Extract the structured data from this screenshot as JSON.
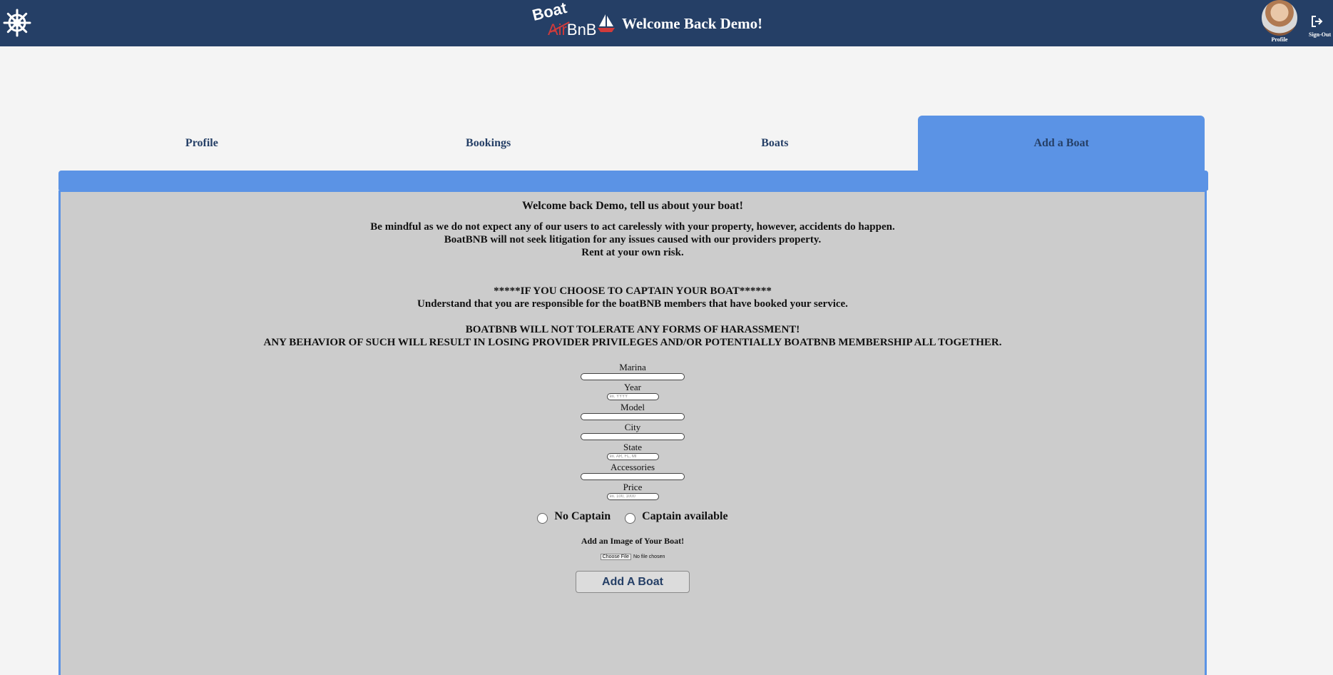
{
  "header": {
    "welcome": "Welcome Back Demo!",
    "logo": {
      "top": "Boat",
      "air": "Air",
      "bnb": "BnB"
    },
    "profile_label": "Profile",
    "signout_label": "Sign-Out",
    "colors": {
      "bar": "#253f66",
      "accent": "#5b93e5",
      "strike": "#d13b3b"
    },
    "icons": [
      "ship-wheel-icon",
      "sailboat-icon",
      "sign-out-icon"
    ]
  },
  "tabs": [
    {
      "label": "Profile",
      "active": false
    },
    {
      "label": "Bookings",
      "active": false
    },
    {
      "label": "Boats",
      "active": false
    },
    {
      "label": "Add a Boat",
      "active": true
    }
  ],
  "panel": {
    "heading": "Welcome back Demo, tell us about your boat!",
    "notice": [
      "Be mindful as we do not expect any of our users to act carelessly with your property, however, accidents do happen.",
      "BoatBNB will not seek litigation for any issues caused with our providers property.",
      "Rent at your own risk."
    ],
    "captain_notice": [
      "*****IF YOU CHOOSE TO CAPTAIN YOUR BOAT******",
      "Understand that you are responsible for the boatBNB members that have booked your service."
    ],
    "harassment": [
      "BOATBNB WILL NOT TOLERATE ANY FORMS OF HARASSMENT!",
      "ANY BEHAVIOR OF SUCH WILL RESULT IN LOSING PROVIDER PRIVILEGES AND/OR POTENTIALLY BOATBNB MEMBERSHIP ALL TOGETHER."
    ]
  },
  "form": {
    "marina": {
      "label": "Marina",
      "value": ""
    },
    "year": {
      "label": "Year",
      "value": "",
      "placeholder": "ex. YYYY"
    },
    "model": {
      "label": "Model",
      "value": ""
    },
    "city": {
      "label": "City",
      "value": ""
    },
    "state": {
      "label": "State",
      "value": "",
      "placeholder": "ex. AR, FL, MI"
    },
    "accessories": {
      "label": "Accessories",
      "value": ""
    },
    "price": {
      "label": "Price",
      "value": "",
      "placeholder": "ex. 100, 1000"
    },
    "captain_options": [
      "No Captain",
      "Captain available"
    ],
    "image_label": "Add an Image of Your Boat!",
    "file_button": "Choose File",
    "file_status": "No file chosen",
    "submit_label": "Add A Boat"
  }
}
